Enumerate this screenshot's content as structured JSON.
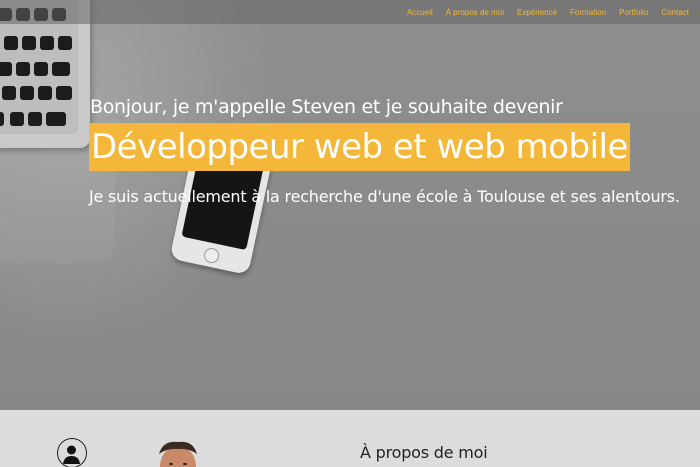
{
  "nav": {
    "items": [
      {
        "label": "Accueil"
      },
      {
        "label": "À propos de moi"
      },
      {
        "label": "Expérience"
      },
      {
        "label": "Formation"
      },
      {
        "label": "Portfolio"
      },
      {
        "label": "Contact"
      }
    ]
  },
  "hero": {
    "intro": "Bonjour, je m'appelle Steven et je souhaite devenir",
    "headline": "Développeur web et web mobile",
    "subtitle": "Je suis actuellement à la recherche d'une école à Toulouse et ses alentours."
  },
  "about": {
    "title": "À propos de moi",
    "icon": "user-icon"
  },
  "colors": {
    "accent": "#f4b73a",
    "nav_text": "#f2b632",
    "hero_overlay": "#8c8c8c",
    "section_bg": "#dcdcdc"
  }
}
